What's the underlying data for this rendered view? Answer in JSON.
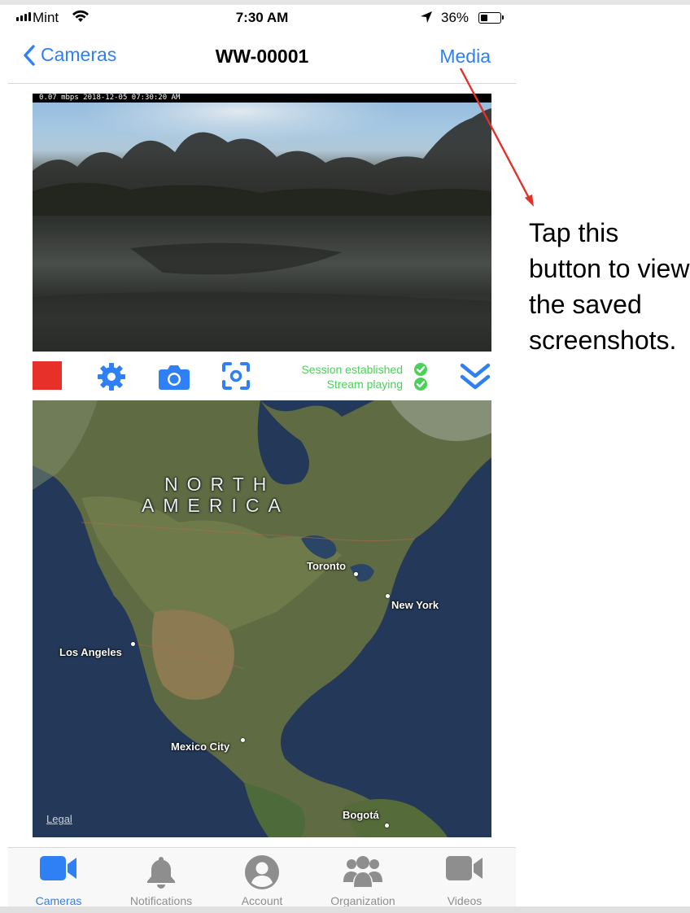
{
  "status_bar": {
    "carrier": "Mint",
    "time": "7:30 AM",
    "battery_percent": "36%",
    "battery_level": 0.36
  },
  "nav": {
    "back_label": "Cameras",
    "title": "WW-00001",
    "media_label": "Media"
  },
  "camera": {
    "overlay_text": "0.07 mbps 2018-12-05 07:30:20 AM"
  },
  "controls": {
    "session_status": "Session established",
    "stream_status": "Stream playing"
  },
  "map": {
    "region_line1": "NORTH",
    "region_line2": "AMERICA",
    "cities": {
      "toronto": "Toronto",
      "new_york": "New York",
      "los_angeles": "Los Angeles",
      "mexico_city": "Mexico City",
      "bogota": "Bogotá"
    },
    "legal_link": "Legal"
  },
  "tabs": [
    {
      "label": "Cameras",
      "icon": "video-camera-icon",
      "active": true
    },
    {
      "label": "Notifications",
      "icon": "bell-icon",
      "active": false
    },
    {
      "label": "Account",
      "icon": "user-circle-icon",
      "active": false
    },
    {
      "label": "Organization",
      "icon": "users-icon",
      "active": false
    },
    {
      "label": "Videos",
      "icon": "video-camera-icon",
      "active": false
    }
  ],
  "annotation": {
    "callout_text": "Tap this button to view the saved screenshots."
  },
  "colors": {
    "accent": "#2f7ff5",
    "record": "#e8302a",
    "status_green": "#4cd05a",
    "annotation_arrow": "#e0312b"
  }
}
